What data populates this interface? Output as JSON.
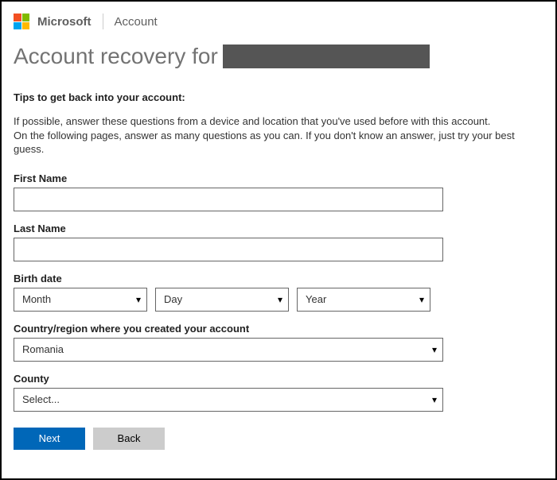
{
  "header": {
    "brand": "Microsoft",
    "section": "Account"
  },
  "page_title_prefix": "Account recovery for",
  "tips": {
    "heading": "Tips to get back into your account:",
    "line1": "If possible, answer these questions from a device and location that you've used before with this account.",
    "line2": "On the following pages, answer as many questions as you can. If you don't know an answer, just try your best guess."
  },
  "labels": {
    "first_name": "First Name",
    "last_name": "Last Name",
    "birth_date": "Birth date",
    "country": "Country/region where you created your account",
    "county": "County"
  },
  "birthdate": {
    "month": "Month",
    "day": "Day",
    "year": "Year"
  },
  "country_value": "Romania",
  "county_value": "Select...",
  "buttons": {
    "next": "Next",
    "back": "Back"
  }
}
